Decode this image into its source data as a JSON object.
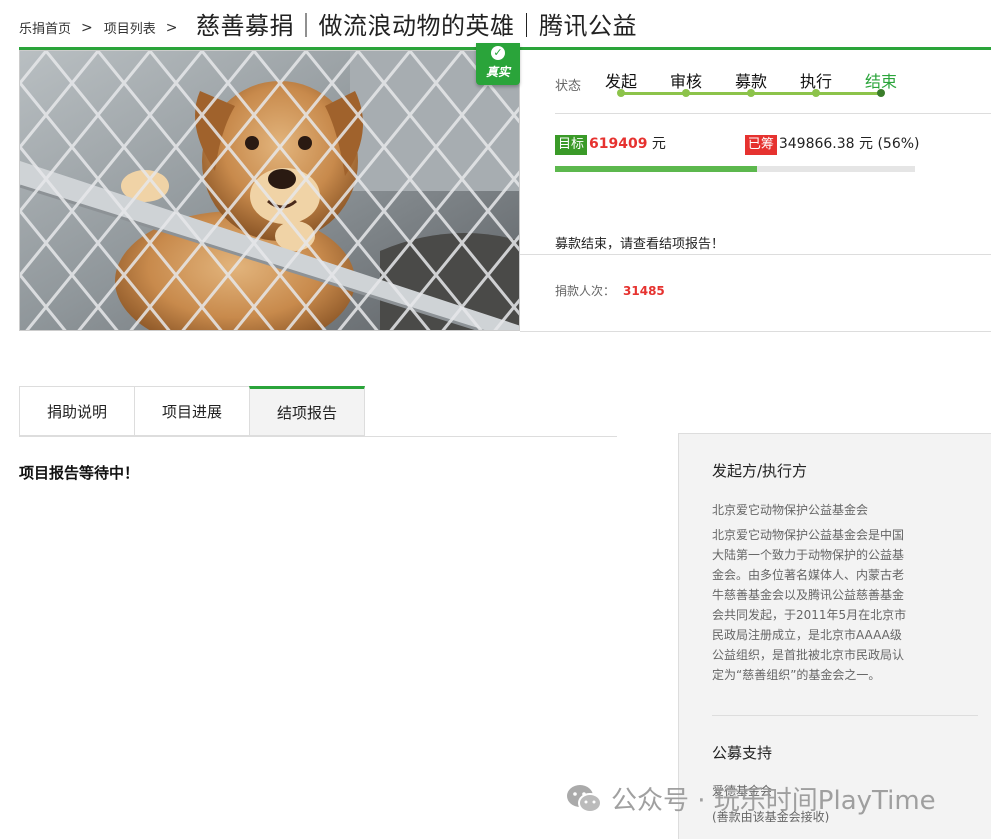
{
  "breadcrumb": {
    "home": "乐捐首页",
    "list": "项目列表",
    "sep": ">"
  },
  "title": "慈善募捐｜做流浪动物的英雄｜腾讯公益",
  "badge": {
    "label": "真实",
    "icon": "check-icon"
  },
  "status": {
    "label": "状态",
    "steps": [
      "发起",
      "审核",
      "募款",
      "执行",
      "结束"
    ],
    "active_index": 4
  },
  "funding": {
    "target_tag": "目标",
    "target_amount": "619409",
    "unit": "元",
    "raised_tag": "已筹",
    "raised_amount": "349866.38",
    "percent_text": "(56%)",
    "progress_fraction": 0.56
  },
  "ended_message": "募款结束，请查看结项报告！",
  "donors": {
    "label": "捐款人次：",
    "count": "31485"
  },
  "tabs": [
    {
      "label": "捐助说明",
      "active": false
    },
    {
      "label": "项目进展",
      "active": false
    },
    {
      "label": "结项报告",
      "active": true
    }
  ],
  "report_text": "项目报告等待中！",
  "sidebar": {
    "initiator_heading": "发起方/执行方",
    "org_name": "北京爱它动物保护公益基金会",
    "org_desc": "北京爱它动物保护公益基金会是中国大陆第一个致力于动物保护的公益基金会。由多位著名媒体人、内蒙古老牛慈善基金会以及腾讯公益慈善基金会共同发起，于2011年5月在北京市民政局注册成立，是北京市AAAA级公益组织，是首批被北京市民政局认定为“慈善组织”的基金会之一。",
    "support_heading": "公募支持",
    "support_org": "爱德基金会",
    "support_note": "(善款由该基金会接收)"
  },
  "watermark": {
    "text": "公众号 · 玩乐时间PlayTime",
    "icon": "wechat-icon"
  },
  "colors": {
    "accent_green": "#2aa43a",
    "step_green": "#8cc34a",
    "red": "#e6322f"
  }
}
